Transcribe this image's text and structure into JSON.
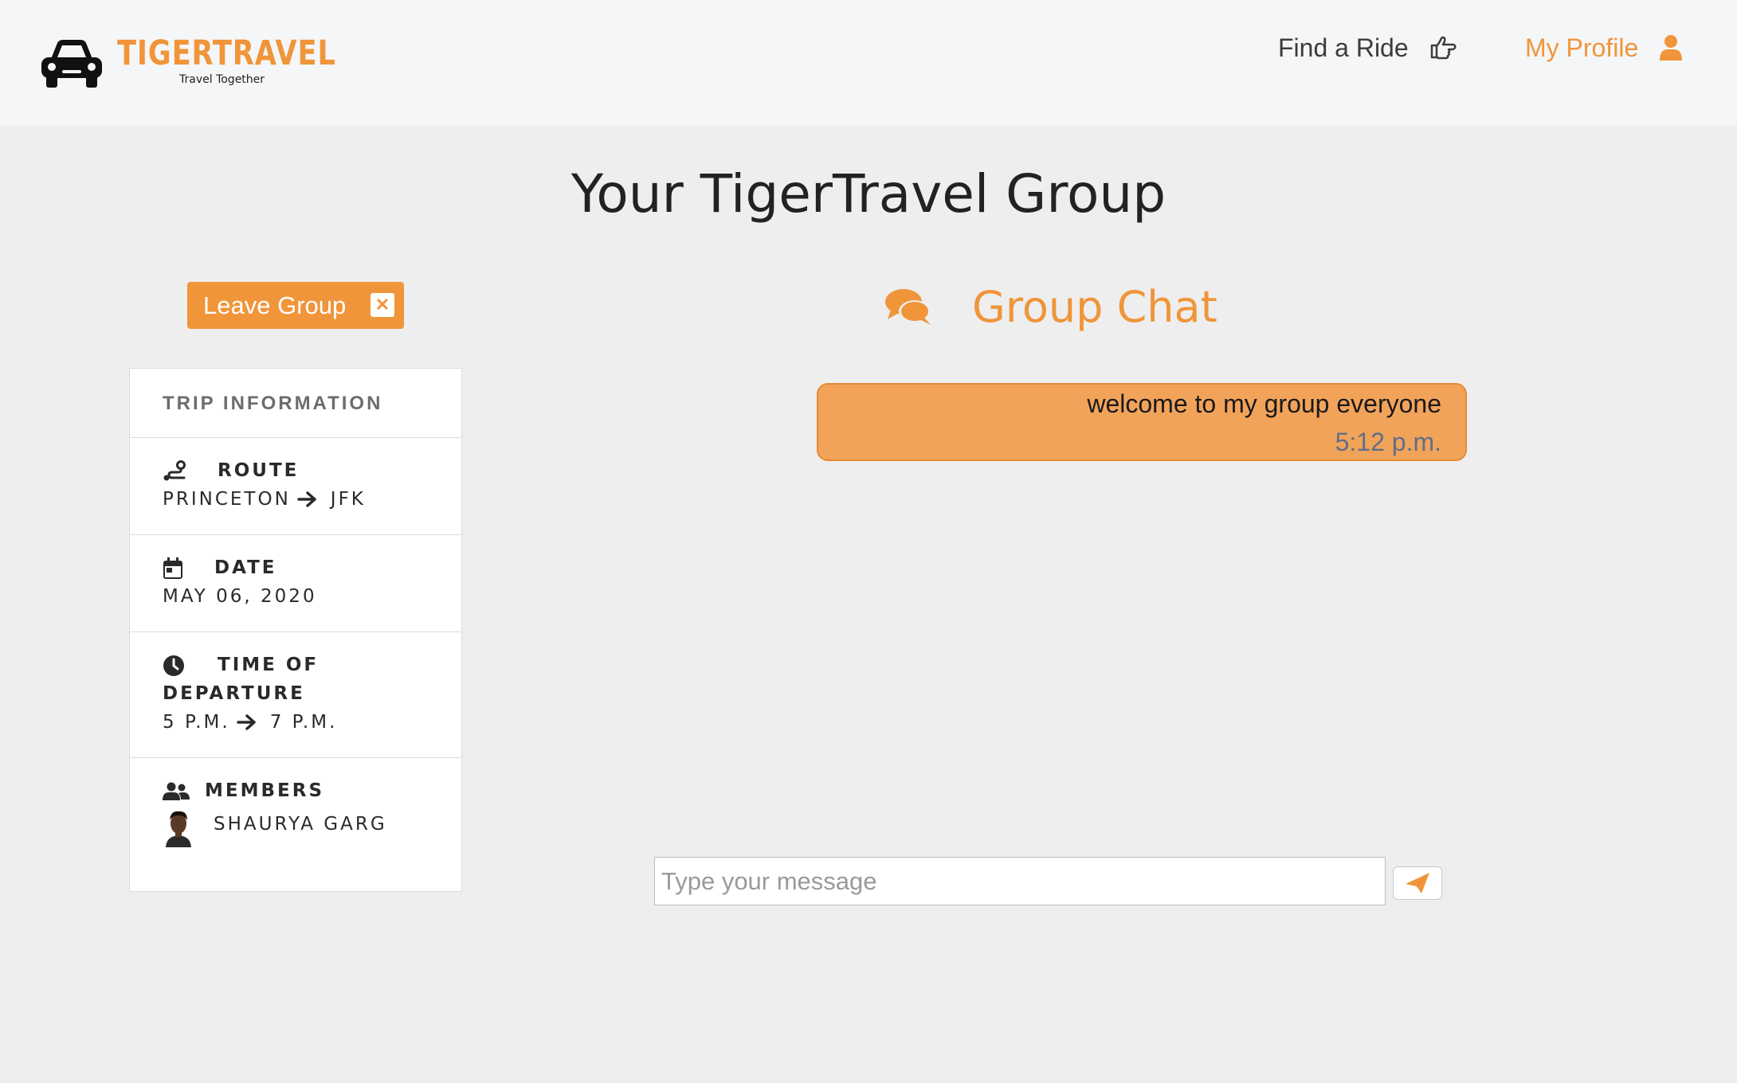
{
  "brand": {
    "name": "TIGERTRAVEL",
    "tagline": "Travel Together",
    "accent_color": "#f0953a"
  },
  "nav": {
    "find_ride": {
      "label": "Find a Ride",
      "icon": "hand-point-right-icon"
    },
    "my_profile": {
      "label": "My Profile",
      "icon": "user-icon"
    }
  },
  "page": {
    "title": "Your TigerTravel Group"
  },
  "leave_button": {
    "label": "Leave Group",
    "icon": "close-square-icon"
  },
  "trip": {
    "header": "TRIP INFORMATION",
    "route": {
      "label": "ROUTE",
      "from": "PRINCETON",
      "to": "JFK",
      "icon": "route-icon"
    },
    "date": {
      "label": "DATE",
      "value": "MAY 06, 2020",
      "icon": "calendar-icon"
    },
    "time": {
      "label_line1": "TIME OF",
      "label_line2": "DEPARTURE",
      "from": "5 P.M.",
      "to": "7 P.M.",
      "icon": "clock-icon"
    },
    "members": {
      "label": "MEMBERS",
      "icon": "users-icon",
      "list": [
        {
          "name": "SHAURYA GARG"
        }
      ]
    }
  },
  "chat": {
    "heading": "Group Chat",
    "icon": "comments-icon",
    "messages": [
      {
        "text": "welcome to my group everyone",
        "time": "5:12 p.m."
      }
    ],
    "input_placeholder": "Type your message",
    "input_value": "",
    "send_icon": "paper-plane-icon"
  }
}
